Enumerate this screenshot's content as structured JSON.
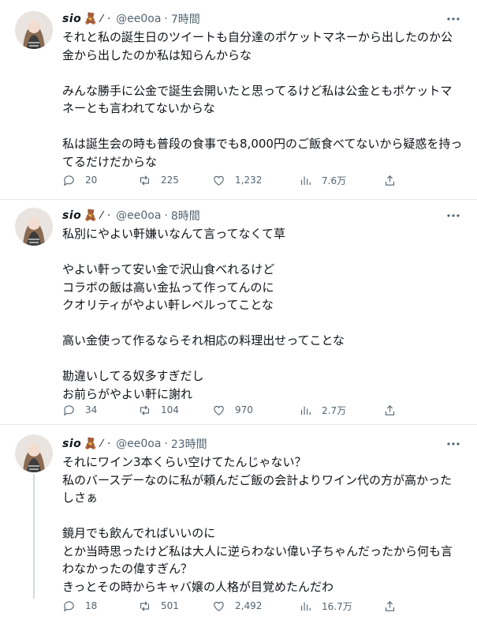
{
  "tweets": [
    {
      "display_name": "sio",
      "badge_emoji": "🧸",
      "name_deco": "⁄ ·",
      "handle": "@ee0oa",
      "time": "7時間",
      "lines": [
        "それと私の誕生日のツイートも自分達のポケットマネーから出したのか公",
        "金から出したのか私は知らんからな",
        "",
        "みんな勝手に公金で誕生会開いたと思ってるけど私は公金ともポケットマ",
        "ネーとも言われてないからな",
        "",
        "私は誕生会の時も普段の食事でも8,000円のご飯食べてないから疑惑を持っ",
        "てるだけだからな"
      ],
      "replies": "20",
      "retweets": "225",
      "likes": "1,232",
      "views": "7.6万"
    },
    {
      "display_name": "sio",
      "badge_emoji": "🧸",
      "name_deco": "⁄ ·",
      "handle": "@ee0oa",
      "time": "8時間",
      "lines": [
        "私別にやよい軒嫌いなんて言ってなくて草",
        "",
        "やよい軒って安い金で沢山食べれるけど",
        "コラボの飯は高い金払って作ってんのに",
        "クオリティがやよい軒レベルってことな",
        "",
        "高い金使って作るならそれ相応の料理出せってことな",
        "",
        "勘違いしてる奴多すぎだし",
        "お前らがやよい軒に謝れ"
      ],
      "replies": "34",
      "retweets": "104",
      "likes": "970",
      "views": "2.7万"
    },
    {
      "display_name": "sio",
      "badge_emoji": "🧸",
      "name_deco": "⁄ ·",
      "handle": "@ee0oa",
      "time": "23時間",
      "lines": [
        "それにワイン3本くらい空けてたんじゃない？",
        "私のバースデーなのに私が頼んだご飯の会計よりワイン代の方が高かった",
        "しさぁ",
        "",
        "鏡月でも飲んでればいいのに",
        "とか当時思ったけど私は大人に逆らわない偉い子ちゃんだったから何も言",
        "わなかったの偉すぎん？",
        "きっとその時からキャバ嬢の人格が目覚めたんだわ"
      ],
      "replies": "18",
      "retweets": "501",
      "likes": "2,492",
      "views": "16.7万"
    }
  ],
  "icons": {
    "more": "more-horizontal-icon",
    "reply": "reply-bubble-icon",
    "retweet": "retweet-arrows-icon",
    "like": "heart-icon",
    "views": "bar-chart-icon",
    "share": "share-upload-icon"
  },
  "colors": {
    "text": "#0f1419",
    "secondary": "#536471",
    "divider": "#e6ecf0"
  }
}
